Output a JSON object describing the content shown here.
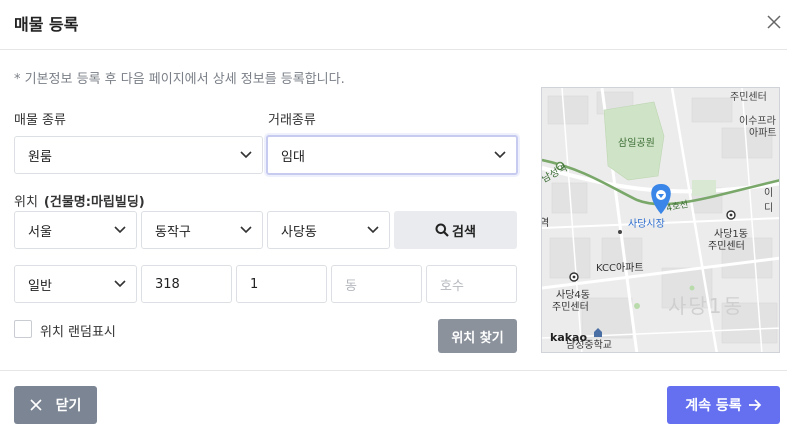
{
  "dialog": {
    "title": "매물 등록",
    "notice": "* 기본정보 등록 후 다음 페이지에서 상세 정보를 등록합니다."
  },
  "property_type": {
    "label": "매물 종류",
    "value": "원룸"
  },
  "deal_type": {
    "label": "거래종류",
    "value": "임대"
  },
  "location": {
    "label": "위치",
    "building_name": "(건물명:마립빌딩)",
    "city": "서울",
    "district": "동작구",
    "dong": "사당동",
    "search_label": "검색",
    "address_type": "일반",
    "main_number": "318",
    "sub_number": "1",
    "building_dong_placeholder": "동",
    "unit_placeholder": "호수",
    "random_label": "위치 랜덤표시",
    "find_label": "위치 찾기"
  },
  "map": {
    "labels": {
      "residents_top": "주민센터",
      "park": "삼일공원",
      "isu": "이수프라",
      "apt": "아파트",
      "line": "남성역",
      "line4": "4호선",
      "mart": "이디",
      "market": "사당시장",
      "sadang1": "사당1동",
      "sadang1_center": "주민센터",
      "kcc": "KCC아파트",
      "sadang4": "사당4동",
      "sadang4_center": "주민센터",
      "big": "사당1동",
      "school": "남성중학교",
      "station_edge": "역",
      "logo": "kakao"
    }
  },
  "footer": {
    "close_label": "닫기",
    "next_label": "계속 등록"
  },
  "colors": {
    "primary": "#6470f0",
    "secondary": "#7c8594",
    "find_button": "#8b929c",
    "map_pin": "#3a86e8"
  }
}
